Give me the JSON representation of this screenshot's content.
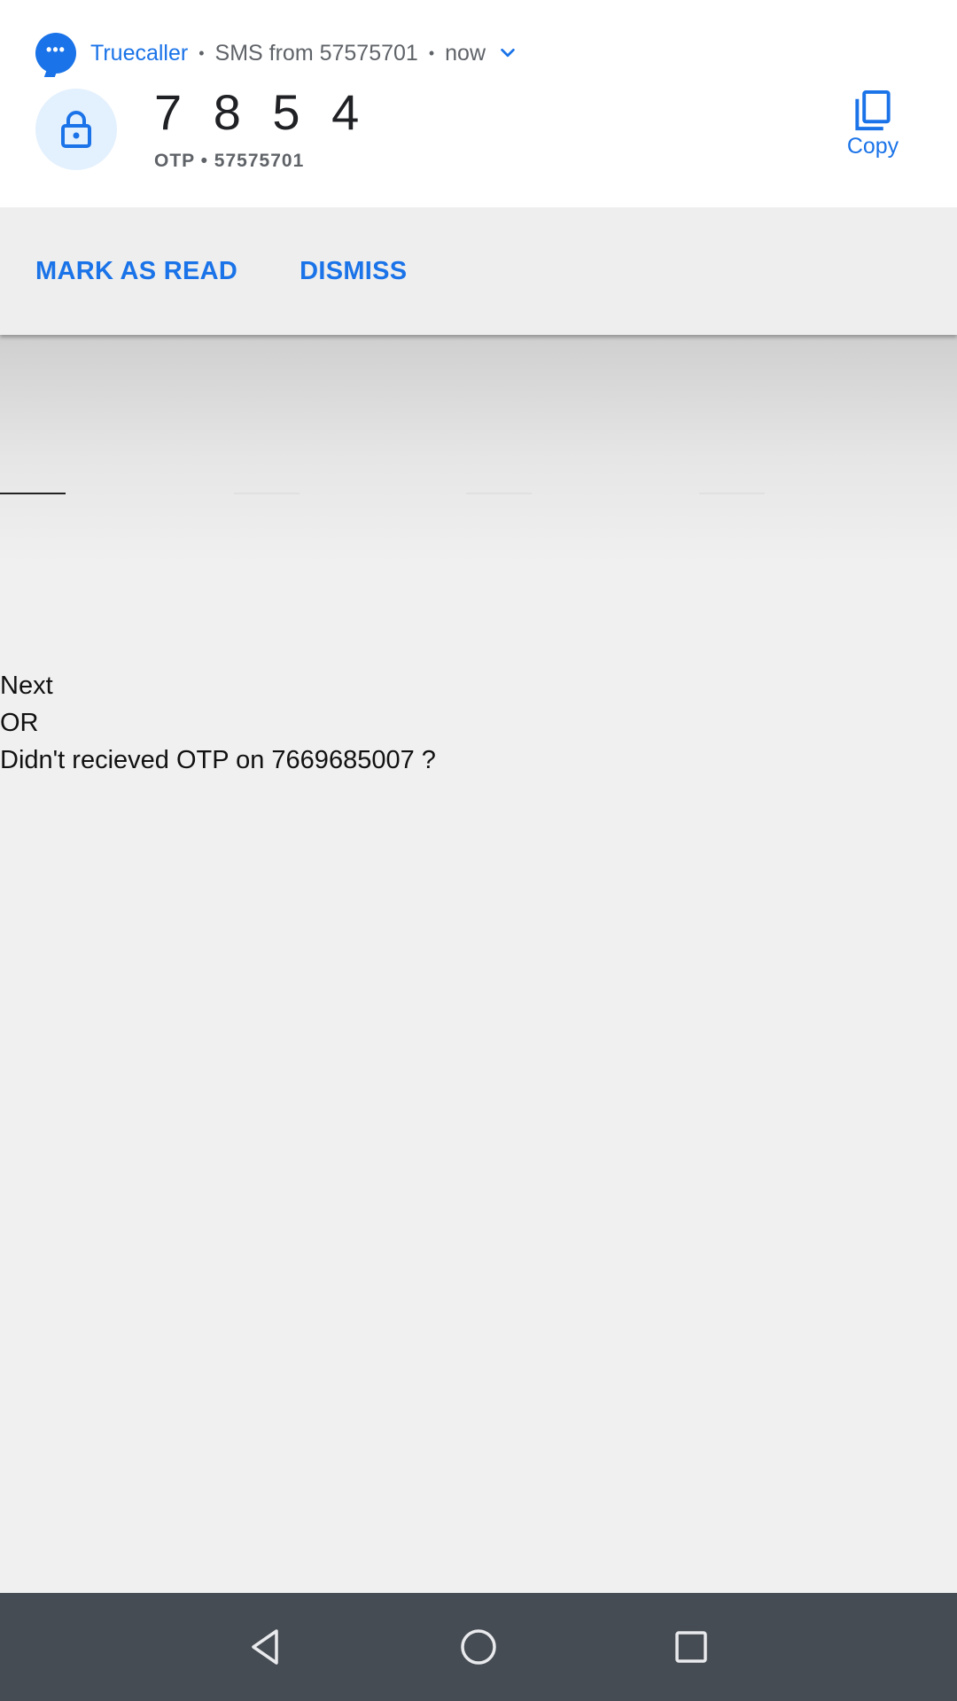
{
  "notification": {
    "app_name": "Truecaller",
    "source": "SMS from 57575701",
    "time": "now",
    "otp_code": "7 8 5 4",
    "otp_subtitle": "OTP • 57575701",
    "copy_label": "Copy",
    "actions": {
      "mark_read": "MARK AS READ",
      "dismiss": "DISMISS"
    },
    "accent_color": "#1a73e8"
  },
  "otp_form": {
    "fields": [
      "",
      "",
      "",
      ""
    ],
    "active_field": 0,
    "next_label": "Next",
    "or_label": "OR",
    "resend_text": "Didn't recieved OTP on 7669685007 ?"
  },
  "navbar": {
    "back_icon": "back-triangle-icon",
    "home_icon": "home-circle-icon",
    "recents_icon": "recents-square-icon"
  }
}
